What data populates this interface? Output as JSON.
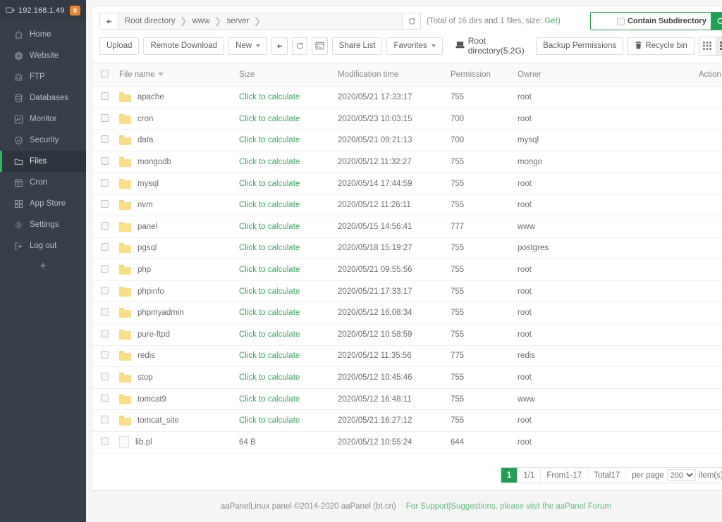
{
  "sidebar": {
    "host": "192.168.1.49",
    "badge": "0",
    "logo_icon": "monitor-icon",
    "add_label": "+",
    "items": [
      {
        "label": "Home",
        "icon": "home-icon",
        "active": false
      },
      {
        "label": "Website",
        "icon": "globe-icon",
        "active": false
      },
      {
        "label": "FTP",
        "icon": "ftp-icon",
        "active": false
      },
      {
        "label": "Databases",
        "icon": "database-icon",
        "active": false
      },
      {
        "label": "Monitor",
        "icon": "monitor-chart-icon",
        "active": false
      },
      {
        "label": "Security",
        "icon": "shield-icon",
        "active": false
      },
      {
        "label": "Files",
        "icon": "folder-icon",
        "active": true
      },
      {
        "label": "Cron",
        "icon": "calendar-icon",
        "active": false
      },
      {
        "label": "App Store",
        "icon": "grid-icon",
        "active": false
      },
      {
        "label": "Settings",
        "icon": "gear-icon",
        "active": false
      },
      {
        "label": "Log out",
        "icon": "logout-icon",
        "active": false
      }
    ]
  },
  "breadcrumb": {
    "back_icon": "arrow-left-icon",
    "refresh_icon": "refresh-icon",
    "items": [
      "Root directory",
      "www",
      "server"
    ]
  },
  "totals": {
    "text": "(Total of 16 dirs and 1 files, size: ",
    "link": "Get",
    "suffix": ")"
  },
  "search": {
    "value": "",
    "placeholder": "",
    "subdirectory_label": "Contain Subdirectory",
    "subdirectory_checked": false,
    "button_icon": "search-icon"
  },
  "toolbar": {
    "upload": "Upload",
    "remote_download": "Remote Download",
    "new": "New",
    "back_icon": "arrow-left-icon",
    "refresh_icon": "refresh-icon",
    "terminal_icon": "terminal-icon",
    "share_list": "Share List",
    "favorites": "Favorites",
    "root_info": "Root directory(5.2G)",
    "root_icon": "disk-icon",
    "backup_permissions": "Backup Permissions",
    "recycle_bin": "Recycle bin",
    "recycle_icon": "trash-icon",
    "view_grid_icon": "grid-view-icon",
    "view_list_icon": "list-view-icon",
    "active_view": "list"
  },
  "table": {
    "columns": [
      "File name",
      "Size",
      "Modification time",
      "Permission",
      "Owner",
      "Action"
    ],
    "sort_column": "File name",
    "rows": [
      {
        "name": "apache",
        "type": "folder",
        "size": "Click to calculate",
        "time": "2020/05/21 17:33:17",
        "permission": "755",
        "owner": "root"
      },
      {
        "name": "cron",
        "type": "folder",
        "size": "Click to calculate",
        "time": "2020/05/23 10:03:15",
        "permission": "700",
        "owner": "root"
      },
      {
        "name": "data",
        "type": "folder",
        "size": "Click to calculate",
        "time": "2020/05/21 09:21:13",
        "permission": "700",
        "owner": "mysql"
      },
      {
        "name": "mongodb",
        "type": "folder",
        "size": "Click to calculate",
        "time": "2020/05/12 11:32:27",
        "permission": "755",
        "owner": "mongo"
      },
      {
        "name": "mysql",
        "type": "folder",
        "size": "Click to calculate",
        "time": "2020/05/14 17:44:59",
        "permission": "755",
        "owner": "root"
      },
      {
        "name": "nvm",
        "type": "folder",
        "size": "Click to calculate",
        "time": "2020/05/12 11:26:11",
        "permission": "755",
        "owner": "root"
      },
      {
        "name": "panel",
        "type": "folder",
        "size": "Click to calculate",
        "time": "2020/05/15 14:56:41",
        "permission": "777",
        "owner": "www"
      },
      {
        "name": "pgsql",
        "type": "folder",
        "size": "Click to calculate",
        "time": "2020/05/18 15:19:27",
        "permission": "755",
        "owner": "postgres"
      },
      {
        "name": "php",
        "type": "folder",
        "size": "Click to calculate",
        "time": "2020/05/21 09:55:56",
        "permission": "755",
        "owner": "root"
      },
      {
        "name": "phpinfo",
        "type": "folder",
        "size": "Click to calculate",
        "time": "2020/05/21 17:33:17",
        "permission": "755",
        "owner": "root"
      },
      {
        "name": "phpmyadmin",
        "type": "folder",
        "size": "Click to calculate",
        "time": "2020/05/12 16:08:34",
        "permission": "755",
        "owner": "root"
      },
      {
        "name": "pure-ftpd",
        "type": "folder",
        "size": "Click to calculate",
        "time": "2020/05/12 10:58:59",
        "permission": "755",
        "owner": "root"
      },
      {
        "name": "redis",
        "type": "folder",
        "size": "Click to calculate",
        "time": "2020/05/12 11:35:56",
        "permission": "775",
        "owner": "redis"
      },
      {
        "name": "stop",
        "type": "folder",
        "size": "Click to calculate",
        "time": "2020/05/12 10:45:46",
        "permission": "755",
        "owner": "root"
      },
      {
        "name": "tomcat9",
        "type": "folder",
        "size": "Click to calculate",
        "time": "2020/05/12 16:48:11",
        "permission": "755",
        "owner": "www"
      },
      {
        "name": "tomcat_site",
        "type": "folder",
        "size": "Click to calculate",
        "time": "2020/05/21 16:27:12",
        "permission": "755",
        "owner": "root"
      },
      {
        "name": "lib.pl",
        "type": "file",
        "size": "64 B",
        "time": "2020/05/12 10:55:24",
        "permission": "644",
        "owner": "root"
      }
    ]
  },
  "pagination": {
    "current_page": "1",
    "pages": "1/1",
    "range": "From1-17",
    "total": "Total17",
    "per_page_label": "per page",
    "per_page_value": "200",
    "items_label": "item(s)"
  },
  "footer": {
    "copyright": "aaPanelLinux panel ©2014-2020 aaPanel (bt.cn)",
    "support_link": "For Support|Suggestions, please visit the aaPanel Forum"
  },
  "colors": {
    "accent_green": "#20a053",
    "badge_orange": "#f0842a",
    "sidebar": "#37404a"
  }
}
